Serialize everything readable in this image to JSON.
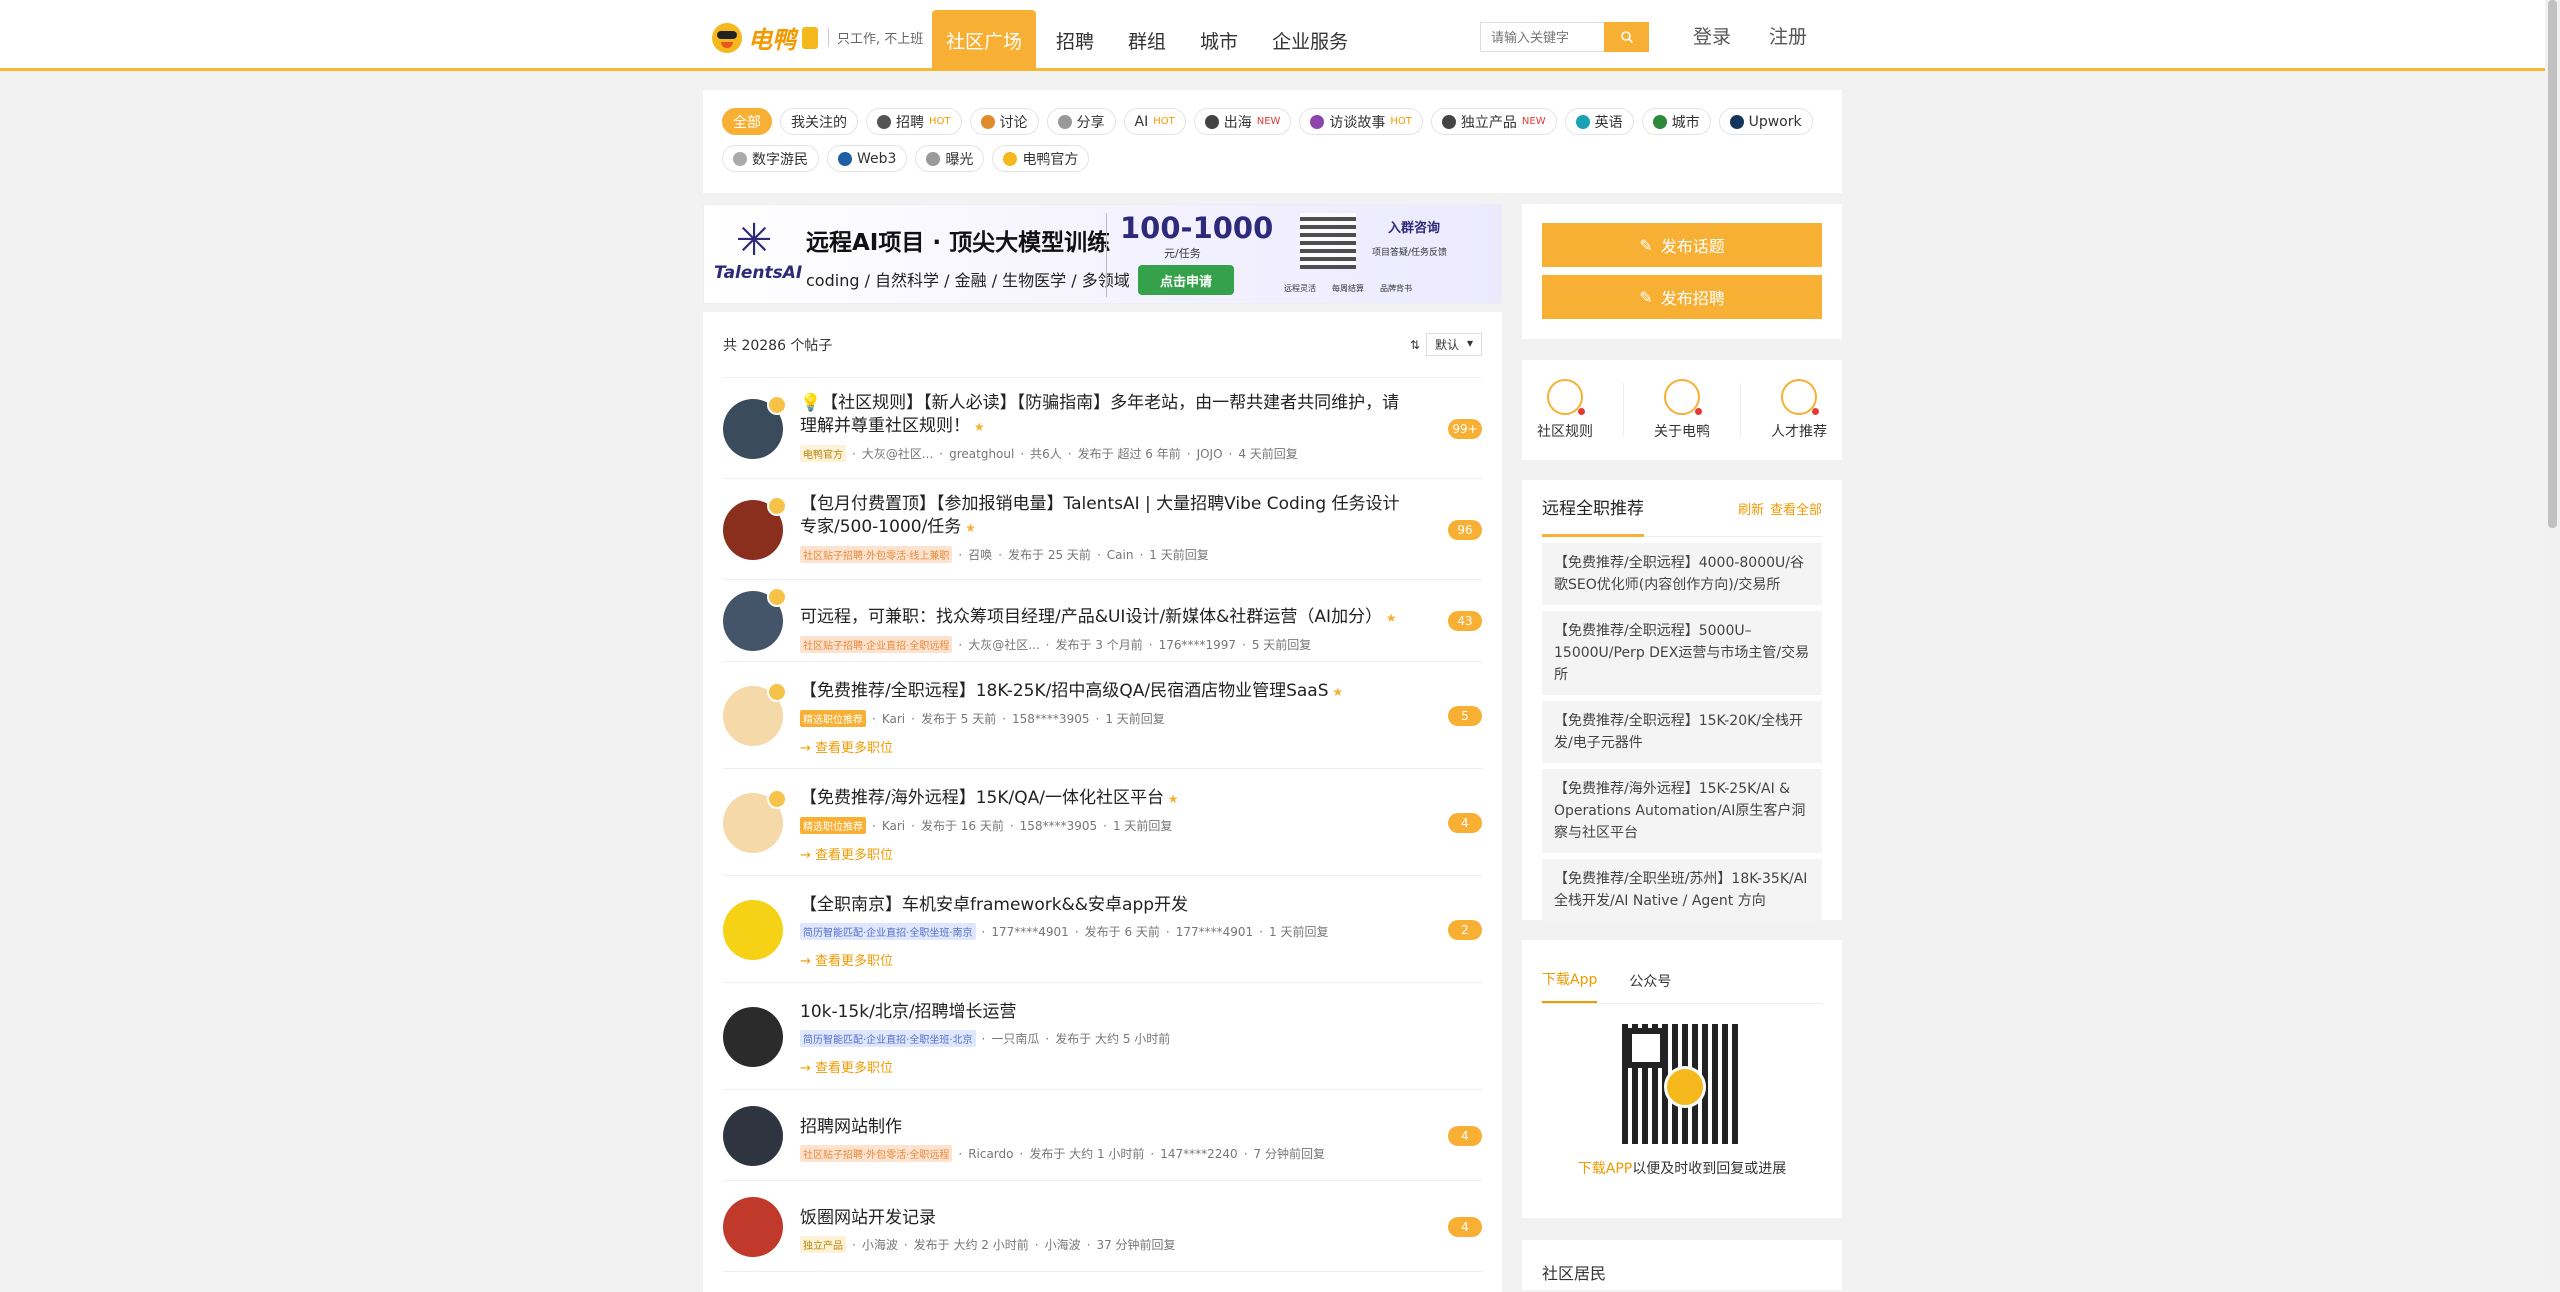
{
  "brand": {
    "name": "电鸭",
    "slogan": "只工作, 不上班"
  },
  "nav": [
    {
      "label": "社区广场",
      "active": true
    },
    {
      "label": "招聘"
    },
    {
      "label": "群组"
    },
    {
      "label": "城市"
    },
    {
      "label": "企业服务"
    }
  ],
  "search": {
    "placeholder": "请输入关键字"
  },
  "auth": {
    "login": "登录",
    "register": "注册"
  },
  "tags_row1": [
    {
      "label": "全部",
      "active": true
    },
    {
      "label": "我关注的"
    },
    {
      "label": "招聘",
      "badge": "HOT",
      "badge_type": "hot",
      "icon": "person-icon",
      "color": "#555"
    },
    {
      "label": "讨论",
      "icon": "chat-icon",
      "color": "#e08a2a"
    },
    {
      "label": "分享",
      "icon": "share-icon",
      "color": "#999"
    },
    {
      "label": "AI",
      "badge": "HOT",
      "badge_type": "hot"
    },
    {
      "label": "出海",
      "badge": "NEW",
      "badge_type": "new",
      "icon": "ship-icon",
      "color": "#444"
    },
    {
      "label": "访谈故事",
      "badge": "HOT",
      "badge_type": "hot",
      "icon": "mic-icon",
      "color": "#8e44ad"
    },
    {
      "label": "独立产品",
      "badge": "NEW",
      "badge_type": "new",
      "icon": "product-icon",
      "color": "#444"
    },
    {
      "label": "英语",
      "icon": "globe-icon",
      "color": "#1aa1b6"
    },
    {
      "label": "城市",
      "icon": "city-icon",
      "color": "#2d8a3a"
    },
    {
      "label": "Upwork",
      "icon": "upwork-icon",
      "color": "#14365c"
    }
  ],
  "tags_row2": [
    {
      "label": "数字游民",
      "icon": "nomad-icon",
      "color": "#aaa"
    },
    {
      "label": "Web3",
      "icon": "web3-icon",
      "color": "#1f5fa8"
    },
    {
      "label": "曝光",
      "icon": "expose-icon",
      "color": "#999"
    },
    {
      "label": "电鸭官方",
      "icon": "duck-icon",
      "color": "#f5b91e"
    }
  ],
  "banner": {
    "brand": "TalentsAI",
    "title": "远程AI项目 · 顶尖大模型训练",
    "subtitle": "coding / 自然科学 / 金融 / 生物医学 / 多领域",
    "price": "100-1000",
    "unit": "元/任务",
    "cta": "点击申请",
    "consult": "入群咨询",
    "consult_sub": "项目答疑/任务反馈",
    "features": [
      "远程灵活",
      "每周结算",
      "品牌背书"
    ]
  },
  "list": {
    "total": "共 20286 个帖子",
    "sort": "默认"
  },
  "posts": [
    {
      "title": "💡【社区规则】【新人必读】【防骗指南】多年老站，由一帮共建者共同维护，请理解并尊重社区规则！",
      "tag": "电鸭官方",
      "tag_bg": "#fdf2d8",
      "tag_color": "#b8860b",
      "meta": [
        "大灰@社区...",
        "greatghoul",
        "共6人",
        "发布于 超过 6 年前",
        "JOJO",
        "4 天前回复"
      ],
      "count": "99+",
      "avatar": "#3a4b5c",
      "height": 101
    },
    {
      "title": "【包月付费置顶】【参加报销电量】TalentsAI | 大量招聘Vibe Coding 任务设计专家/500-1000/任务",
      "tag": "社区贴子招聘·外包零活·线上兼职",
      "tag_bg": "#fde3cf",
      "tag_color": "#e58a3a",
      "meta": [
        "召唤",
        "发布于 25 天前",
        "Cain",
        "1 天前回复"
      ],
      "count": "96",
      "avatar": "#8a2f1e",
      "height": 101
    },
    {
      "title": "可远程，可兼职：找众筹项目经理/产品&UI设计/新媒体&社群运营（AI加分）",
      "tag": "社区贴子招聘·企业直招·全职远程",
      "tag_bg": "#fde3cf",
      "tag_color": "#e58a3a",
      "meta": [
        "大灰@社区...",
        "发布于 3 个月前",
        "176****1997",
        "5 天前回复"
      ],
      "count": "43",
      "avatar": "#44556a",
      "height": 82
    },
    {
      "title": "【免费推荐/全职远程】18K-25K/招中高级QA/民宿酒店物业管理SaaS",
      "tag": "精选职位推荐",
      "tag_bg": "#f7b034",
      "tag_color": "#ffffff",
      "meta": [
        "Kari",
        "发布于 5 天前",
        "158****3905",
        "1 天前回复"
      ],
      "more": "→ 查看更多职位",
      "count": "5",
      "avatar": "#f5d9a8",
      "height": 107
    },
    {
      "title": "【免费推荐/海外远程】15K/QA/一体化社区平台",
      "tag": "精选职位推荐",
      "tag_bg": "#f7b034",
      "tag_color": "#ffffff",
      "meta": [
        "Kari",
        "发布于 16 天前",
        "158****3905",
        "1 天前回复"
      ],
      "more": "→ 查看更多职位",
      "count": "4",
      "avatar": "#f5d9a8",
      "height": 107
    },
    {
      "title": "【全职南京】车机安卓framework&&安卓app开发",
      "tag": "简历智能匹配·企业直招·全职坐班·南京",
      "tag_bg": "#dfe7ff",
      "tag_color": "#5470c6",
      "meta": [
        "177****4901",
        "发布于 6 天前",
        "177****4901",
        "1 天前回复"
      ],
      "more": "→ 查看更多职位",
      "count": "2",
      "avatar": "#f5d215",
      "height": 107
    },
    {
      "title": "10k-15k/北京/招聘增长运营",
      "tag": "简历智能匹配·企业直招·全职坐班·北京",
      "tag_bg": "#dfe7ff",
      "tag_color": "#5470c6",
      "meta": [
        "一只南瓜",
        "发布于 大约 5 小时前"
      ],
      "more": "→ 查看更多职位",
      "count": "",
      "avatar": "#2b2b2b",
      "height": 107
    },
    {
      "title": "招聘网站制作",
      "tag": "社区贴子招聘·外包零活·全职远程",
      "tag_bg": "#fde3cf",
      "tag_color": "#e58a3a",
      "meta": [
        "Ricardo",
        "发布于 大约 1 小时前",
        "147****2240",
        "7 分钟前回复"
      ],
      "count": "4",
      "avatar": "#2e3440",
      "height": 91
    },
    {
      "title": "饭圈网站开发记录",
      "tag": "独立产品",
      "tag_bg": "#fdf2d8",
      "tag_color": "#b8860b",
      "meta": [
        "小海波",
        "发布于 大约 2 小时前",
        "小海波",
        "37 分钟前回复"
      ],
      "count": "4",
      "avatar": "#c0392b",
      "height": 91
    }
  ],
  "actions": {
    "post_topic": "发布话题",
    "post_job": "发布招聘"
  },
  "quick": [
    {
      "label": "社区规则"
    },
    {
      "label": "关于电鸭"
    },
    {
      "label": "人才推荐"
    }
  ],
  "jobs": {
    "title": "远程全职推荐",
    "refresh": "刷新",
    "view_all": "查看全部",
    "items": [
      "【免费推荐/全职远程】4000-8000U/谷歌SEO优化师(内容创作方向)/交易所",
      "【免费推荐/全职远程】5000U–15000U/Perp DEX运营与市场主管/交易所",
      "【免费推荐/全职远程】15K-20K/全栈开发/电子元器件",
      "【免费推荐/海外远程】15K-25K/AI & Operations Automation/AI原生客户洞察与社区平台",
      "【免费推荐/全职坐班/苏州】18K-35K/AI全栈开发/AI Native / Agent 方向"
    ]
  },
  "app": {
    "tab_app": "下载App",
    "tab_wechat": "公众号",
    "caption_link": "下载APP",
    "caption_rest": "以便及时收到回复或进展"
  },
  "resident": {
    "title": "社区居民"
  },
  "colors": {
    "accent": "#f7b034",
    "link": "#f29a00"
  }
}
